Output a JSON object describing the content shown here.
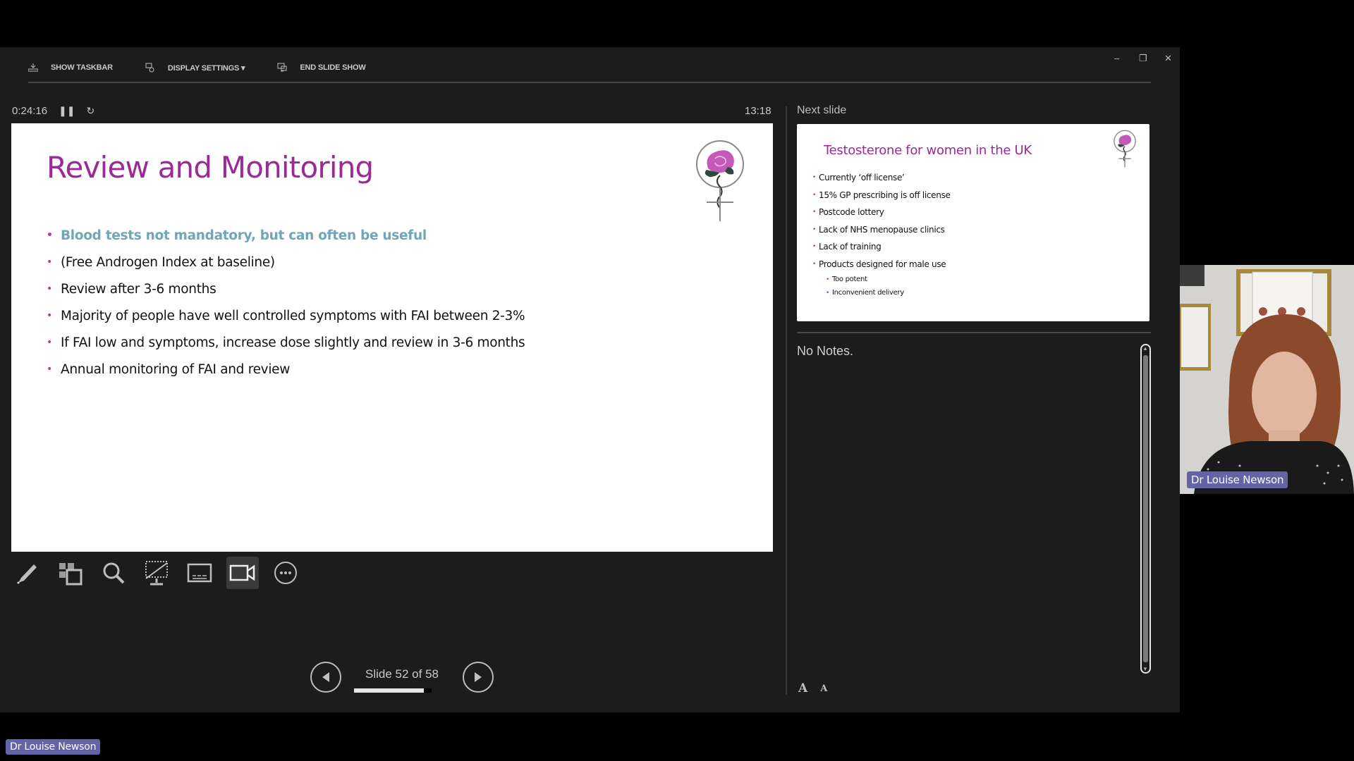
{
  "toolbar": {
    "show_taskbar": "SHOW TASKBAR",
    "display_settings": "DISPLAY SETTINGS ▾",
    "end_slide_show": "END SLIDE SHOW"
  },
  "window_controls": {
    "minimize": "–",
    "restore": "❐",
    "close": "✕"
  },
  "presenter": {
    "elapsed_time": "0:24:16",
    "pause_icon": "❚❚",
    "reset_icon": "↻",
    "clock": "13:18",
    "next_slide_label": "Next slide",
    "notes_text": "No Notes."
  },
  "current_slide": {
    "title": "Review and Monitoring",
    "bullets": [
      "Blood tests not mandatory, but can often be useful",
      "(Free Androgen Index at baseline)",
      "Review after 3-6 months",
      "Majority of people have well controlled symptoms with FAI between 2-3%",
      "If FAI low and symptoms, increase dose slightly and review in 3-6 months",
      "Annual monitoring of FAI and review"
    ],
    "highlight_color": "#6fa6ba",
    "title_color": "#9b2a96"
  },
  "next_slide": {
    "title": "Testosterone for women in the UK",
    "bullets": [
      "Currently ‘off license’",
      "15% GP prescribing is off license",
      "Postcode lottery",
      "Lack of NHS menopause clinics",
      "Lack of training",
      "Products designed for male use"
    ],
    "sub_bullets": [
      "Too potent",
      "Inconvenient delivery"
    ]
  },
  "navigation": {
    "slide_text": "Slide 52 of 58",
    "current": 52,
    "total": 58,
    "progress_fraction": 0.897
  },
  "tools": [
    "pen-icon",
    "see-all-slides-icon",
    "zoom-icon",
    "black-screen-icon",
    "subtitles-icon",
    "camera-icon",
    "more-options-icon"
  ],
  "font_controls": {
    "increase": "A",
    "decrease": "A"
  },
  "participant": {
    "name": "Dr Louise Newson",
    "badge_color": "#6264a7"
  }
}
